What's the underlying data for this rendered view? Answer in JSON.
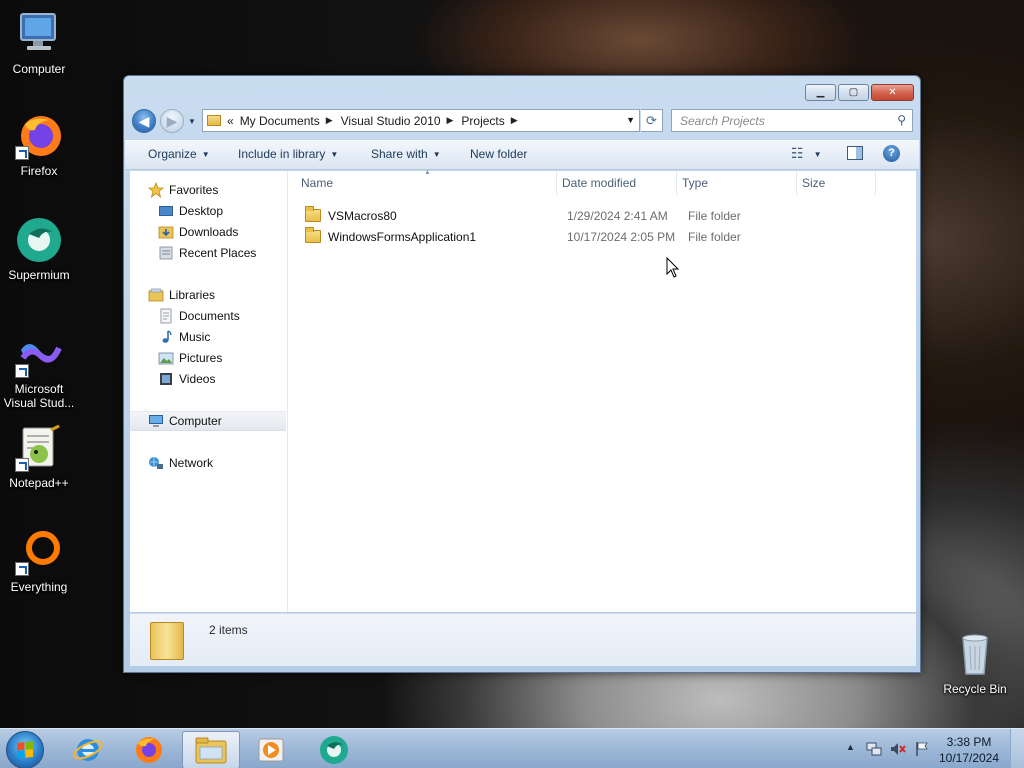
{
  "desktop": {
    "icons": [
      {
        "label": "Computer",
        "icon": "computer-icon"
      },
      {
        "label": "Firefox",
        "icon": "firefox-icon"
      },
      {
        "label": "Supermium",
        "icon": "supermium-icon"
      },
      {
        "label": "Microsoft Visual Stud...",
        "icon": "visual-studio-icon"
      },
      {
        "label": "Notepad++",
        "icon": "notepadpp-icon"
      },
      {
        "label": "Everything",
        "icon": "everything-icon"
      },
      {
        "label": "Recycle Bin",
        "icon": "recycle-bin-icon"
      }
    ]
  },
  "window": {
    "controls": {
      "minimize": "▁",
      "maximize": "▢",
      "close": "✕"
    },
    "address": {
      "overflow": "«",
      "crumbs": [
        "My Documents",
        "Visual Studio 2010",
        "Projects"
      ]
    },
    "search_placeholder": "Search Projects",
    "toolbar": {
      "organize": "Organize",
      "include_in_library": "Include in library",
      "share_with": "Share with",
      "new_folder": "New folder"
    },
    "nav_pane": {
      "favorites": "Favorites",
      "desktop": "Desktop",
      "downloads": "Downloads",
      "recent_places": "Recent Places",
      "libraries": "Libraries",
      "documents": "Documents",
      "music": "Music",
      "pictures": "Pictures",
      "videos": "Videos",
      "computer": "Computer",
      "network": "Network"
    },
    "columns": {
      "name": "Name",
      "date_modified": "Date modified",
      "type": "Type",
      "size": "Size"
    },
    "files": [
      {
        "name": "VSMacros80",
        "date": "1/29/2024 2:41 AM",
        "type": "File folder",
        "size": ""
      },
      {
        "name": "WindowsFormsApplication1",
        "date": "10/17/2024 2:05 PM",
        "type": "File folder",
        "size": ""
      }
    ],
    "details": {
      "item_count": "2 items"
    }
  },
  "taskbar": {
    "apps": [
      {
        "name": "Internet Explorer",
        "icon": "ie-icon",
        "active": false
      },
      {
        "name": "Firefox",
        "icon": "firefox-icon",
        "active": false
      },
      {
        "name": "Windows Explorer",
        "icon": "explorer-icon",
        "active": true
      },
      {
        "name": "Windows Media Player",
        "icon": "media-player-icon",
        "active": false
      },
      {
        "name": "Supermium",
        "icon": "supermium-icon",
        "active": false
      }
    ],
    "tray": {
      "expand": "▲"
    },
    "clock": {
      "time": "3:38 PM",
      "date": "10/17/2024"
    }
  },
  "colors": {
    "window_frame": "#bcd3ea",
    "toolbar_text": "#1e395b",
    "column_header_text": "#4c607a",
    "taskbar": "#9fb9d8"
  }
}
